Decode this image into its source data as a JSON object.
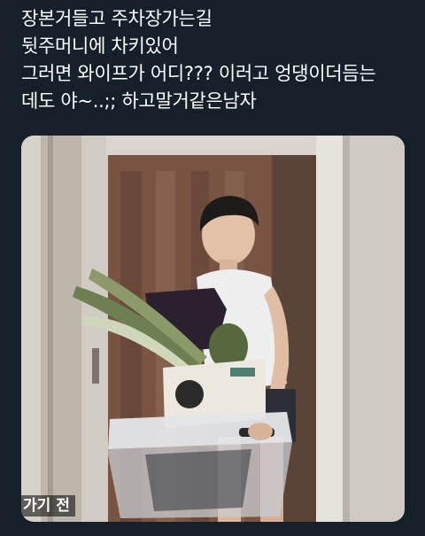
{
  "tweet": {
    "lines": [
      "장본거들고 주차장가는길",
      "뒷주머니에 차키있어",
      "그러면 와이프가 어디??? 이러고 엉댕이더듬는",
      "데도 야~..;; 하고말거같은남자"
    ]
  },
  "media": {
    "caption": "가기 전",
    "colors": {
      "background": "#15202b",
      "door_wood": "#7a5443",
      "wall": "#cfcbc4"
    }
  }
}
